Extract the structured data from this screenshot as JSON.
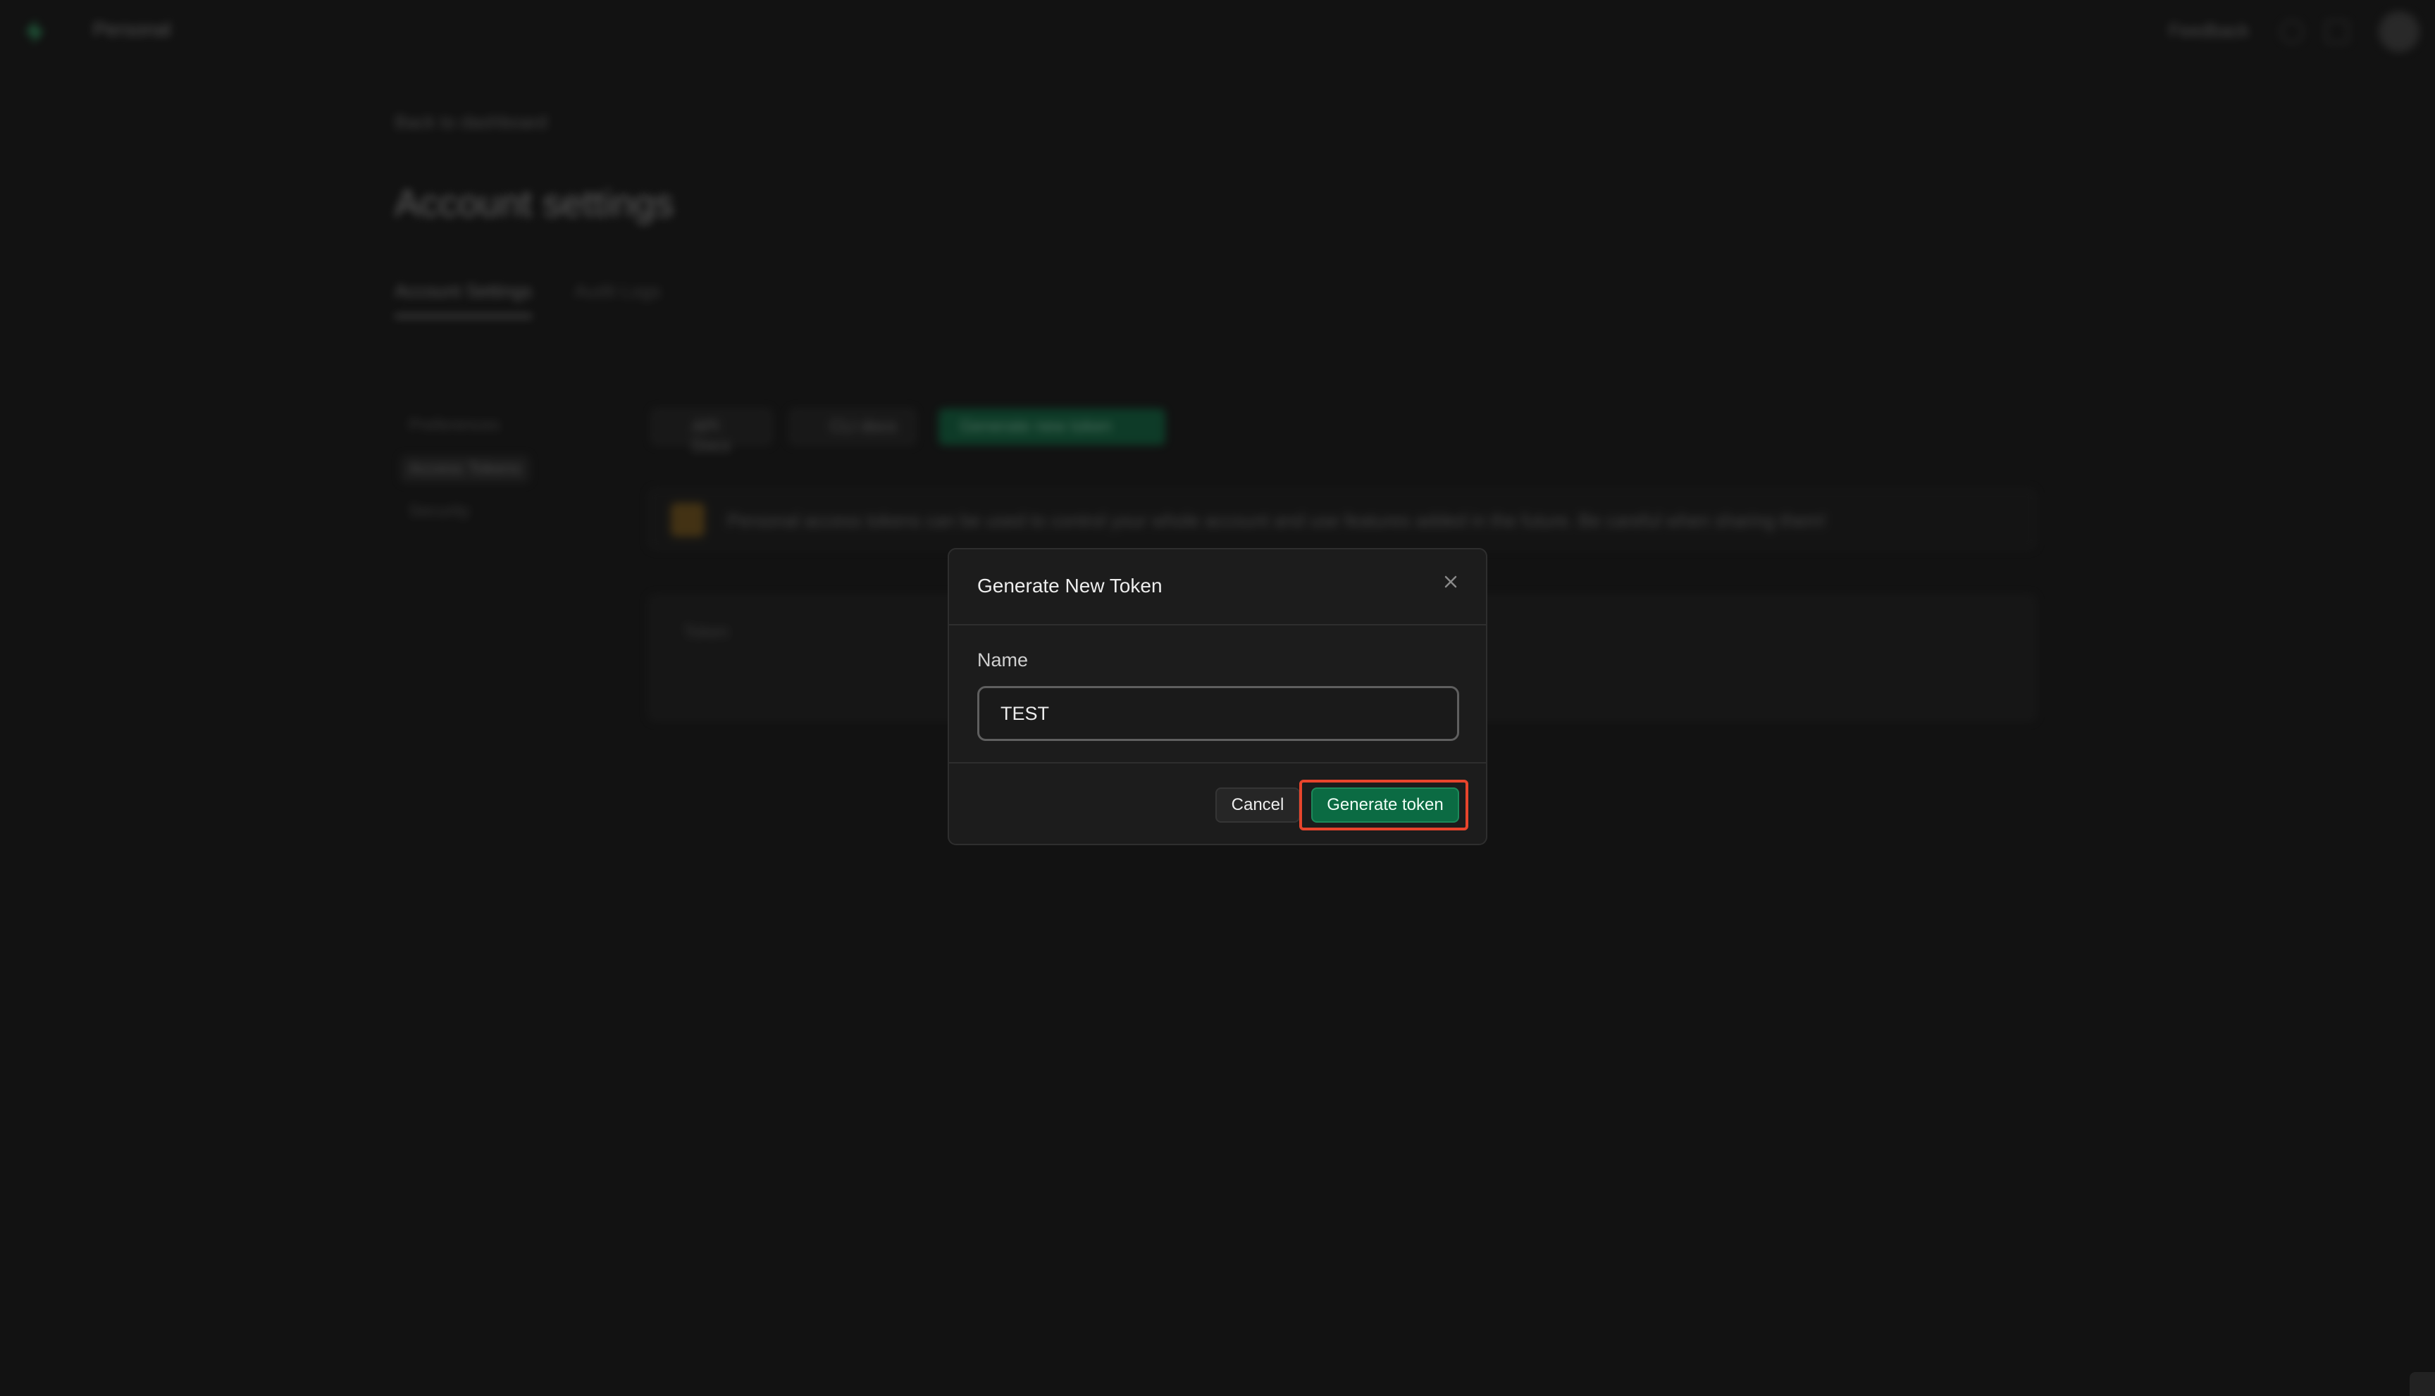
{
  "topbar": {
    "title": "Personal",
    "feedback_label": "Feedback",
    "icons": [
      "help-icon",
      "inbox-icon"
    ]
  },
  "back_link": "Back to dashboard",
  "page_title": "Account settings",
  "tabs": [
    {
      "label": "Account Settings",
      "active": true
    },
    {
      "label": "Audit Logs",
      "active": false
    }
  ],
  "sidebar": {
    "items": [
      {
        "label": "Preferences"
      },
      {
        "label": "Access Tokens",
        "active": true
      },
      {
        "label": "Security"
      }
    ]
  },
  "toolbar": {
    "api_docs": "API Docs",
    "cli_docs": "CLI docs",
    "generate_new": "Generate new token"
  },
  "notice": {
    "text": "Personal access tokens can be used to control your whole account and use features added in the future. Be careful when sharing them!"
  },
  "table": {
    "header_token": "Token"
  },
  "modal": {
    "title": "Generate New Token",
    "name_label": "Name",
    "name_value": "TEST",
    "cancel_label": "Cancel",
    "generate_label": "Generate token"
  },
  "colors": {
    "accent": "#0b6b43",
    "background": "#121212",
    "highlight": "#e8452c"
  }
}
